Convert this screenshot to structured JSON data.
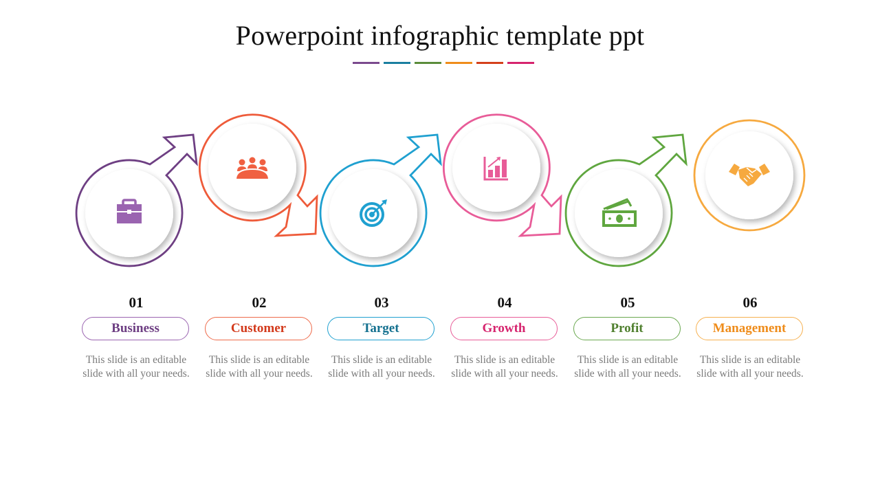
{
  "title": "Powerpoint infographic template ppt",
  "underline_colors": [
    "#7b4a8e",
    "#1a7fa0",
    "#5b8c3a",
    "#ef8c1a",
    "#d4401b",
    "#d6246e"
  ],
  "steps": [
    {
      "number": "01",
      "label": "Business",
      "description": "This slide is an editable slide with all your needs.",
      "icon": "briefcase-icon",
      "ring_color": "#6e3f83",
      "icon_color": "#9a64b0",
      "label_color": "#6e3f83",
      "pill_color": "#9a64b0"
    },
    {
      "number": "02",
      "label": "Customer",
      "description": "This slide is an editable slide with all your needs.",
      "icon": "team-meeting-icon",
      "ring_color": "#ee5b3a",
      "icon_color": "#f06041",
      "label_color": "#d33a1c",
      "pill_color": "#ee6a4a"
    },
    {
      "number": "03",
      "label": "Target",
      "description": "This slide is an editable slide with all your needs.",
      "icon": "target-icon",
      "ring_color": "#1fa0d0",
      "icon_color": "#1fa0d0",
      "label_color": "#13708f",
      "pill_color": "#1fa0d0"
    },
    {
      "number": "04",
      "label": "Growth",
      "description": "This slide is an editable slide with all your needs.",
      "icon": "growth-chart-icon",
      "ring_color": "#e85c98",
      "icon_color": "#e85c98",
      "label_color": "#d6246e",
      "pill_color": "#e85c98"
    },
    {
      "number": "05",
      "label": "Profit",
      "description": "This slide is an editable slide with all your needs.",
      "icon": "money-icon",
      "ring_color": "#5fa63f",
      "icon_color": "#5fa63f",
      "label_color": "#4f7f2e",
      "pill_color": "#6aa84f"
    },
    {
      "number": "06",
      "label": "Management",
      "description": "This slide is an editable slide with all your needs.",
      "icon": "handshake-icon",
      "ring_color": "#f6a93f",
      "icon_color": "#f6a93f",
      "label_color": "#ef8c1a",
      "pill_color": "#f6b04f"
    }
  ]
}
